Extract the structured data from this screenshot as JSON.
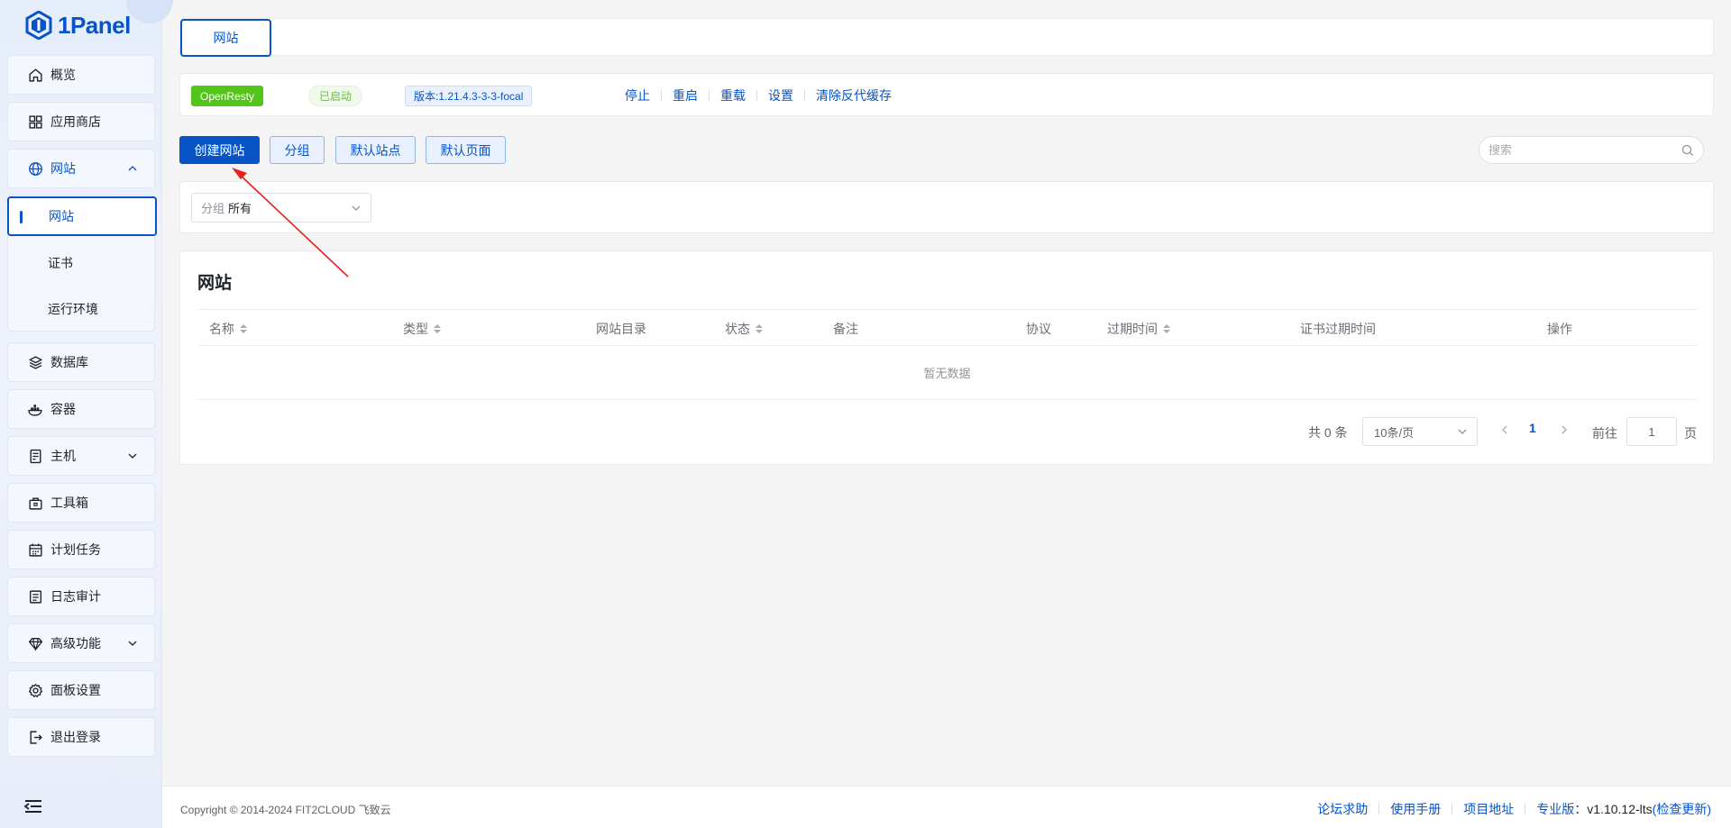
{
  "app": {
    "logo_text": "1Panel"
  },
  "sidebar": {
    "items": [
      {
        "label": "概览",
        "icon": "home-icon"
      },
      {
        "label": "应用商店",
        "icon": "grid-icon"
      },
      {
        "label": "网站",
        "icon": "globe-icon",
        "expanded": true
      },
      {
        "label": "数据库",
        "icon": "layers-icon"
      },
      {
        "label": "容器",
        "icon": "docker-icon"
      },
      {
        "label": "主机",
        "icon": "server-icon"
      },
      {
        "label": "工具箱",
        "icon": "toolbox-icon"
      },
      {
        "label": "计划任务",
        "icon": "calendar-icon"
      },
      {
        "label": "日志审计",
        "icon": "log-icon"
      },
      {
        "label": "高级功能",
        "icon": "diamond-icon"
      },
      {
        "label": "面板设置",
        "icon": "gear-icon"
      },
      {
        "label": "退出登录",
        "icon": "logout-icon"
      }
    ],
    "website_submenu": [
      "网站",
      "证书",
      "运行环境"
    ]
  },
  "tabbar": {
    "active_tab": "网站"
  },
  "status": {
    "app_name": "OpenResty",
    "state": "已启动",
    "version": "版本:1.21.4.3-3-3-focal",
    "actions": [
      "停止",
      "重启",
      "重载",
      "设置",
      "清除反代缓存"
    ],
    "colors": {
      "app_tag": "#52c41a",
      "state_text": "#67c23a"
    }
  },
  "toolbar": {
    "create_label": "创建网站",
    "group_label": "分组",
    "default_site_label": "默认站点",
    "default_page_label": "默认页面",
    "search_placeholder": "搜索"
  },
  "filter": {
    "group_label": "分组",
    "group_value": "所有"
  },
  "table": {
    "title": "网站",
    "columns": [
      {
        "label": "名称",
        "sortable": true
      },
      {
        "label": "类型",
        "sortable": true
      },
      {
        "label": "网站目录",
        "sortable": false
      },
      {
        "label": "状态",
        "sortable": true
      },
      {
        "label": "备注",
        "sortable": false
      },
      {
        "label": "协议",
        "sortable": false
      },
      {
        "label": "过期时间",
        "sortable": true
      },
      {
        "label": "证书过期时间",
        "sortable": false
      },
      {
        "label": "操作",
        "sortable": false
      }
    ],
    "rows": [],
    "empty_text": "暂无数据"
  },
  "pagination": {
    "total_text": "共 0 条",
    "page_size": "10条/页",
    "current_page": "1",
    "goto_label": "前往",
    "goto_value": "1",
    "goto_suffix": "页"
  },
  "footer": {
    "copyright": "Copyright © 2014-2024 FIT2CLOUD 飞致云",
    "links": [
      "论坛求助",
      "使用手册",
      "项目地址"
    ],
    "edition_label": "专业版：",
    "version": "v1.10.12-lts",
    "check_update": "(检查更新)"
  },
  "theme": {
    "accent": "#0854c7",
    "annotation_arrow": "#e8201a"
  }
}
